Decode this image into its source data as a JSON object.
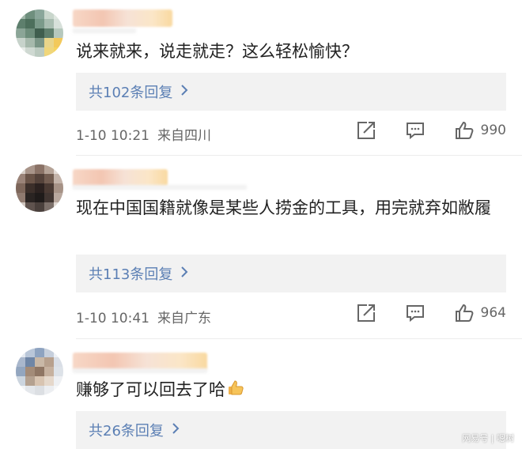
{
  "comments": [
    {
      "text": "说来就来，说走就走？这么轻松愉快？",
      "replies": "共102条回复",
      "time": "1-10 10:21",
      "location": "来自四川",
      "likes": "990"
    },
    {
      "text": "现在中国国籍就像是某些人捞金的工具，用完就弃如敝履",
      "replies": "共113条回复",
      "time": "1-10 10:41",
      "location": "来自广东",
      "likes": "964"
    },
    {
      "text": "赚够了可以回去了哈",
      "replies": "共26条回复"
    }
  ],
  "icons": {
    "share": "share-icon",
    "comment": "comment-icon",
    "like": "thumbs-up-icon",
    "chevron": "chevron-right-icon",
    "emoji": "thumbs-up-emoji"
  },
  "watermark": "网易号 | 嗯树",
  "colors": {
    "link": "#5b7fb4",
    "reply_bg": "#f2f2f2",
    "meta": "#666666"
  }
}
